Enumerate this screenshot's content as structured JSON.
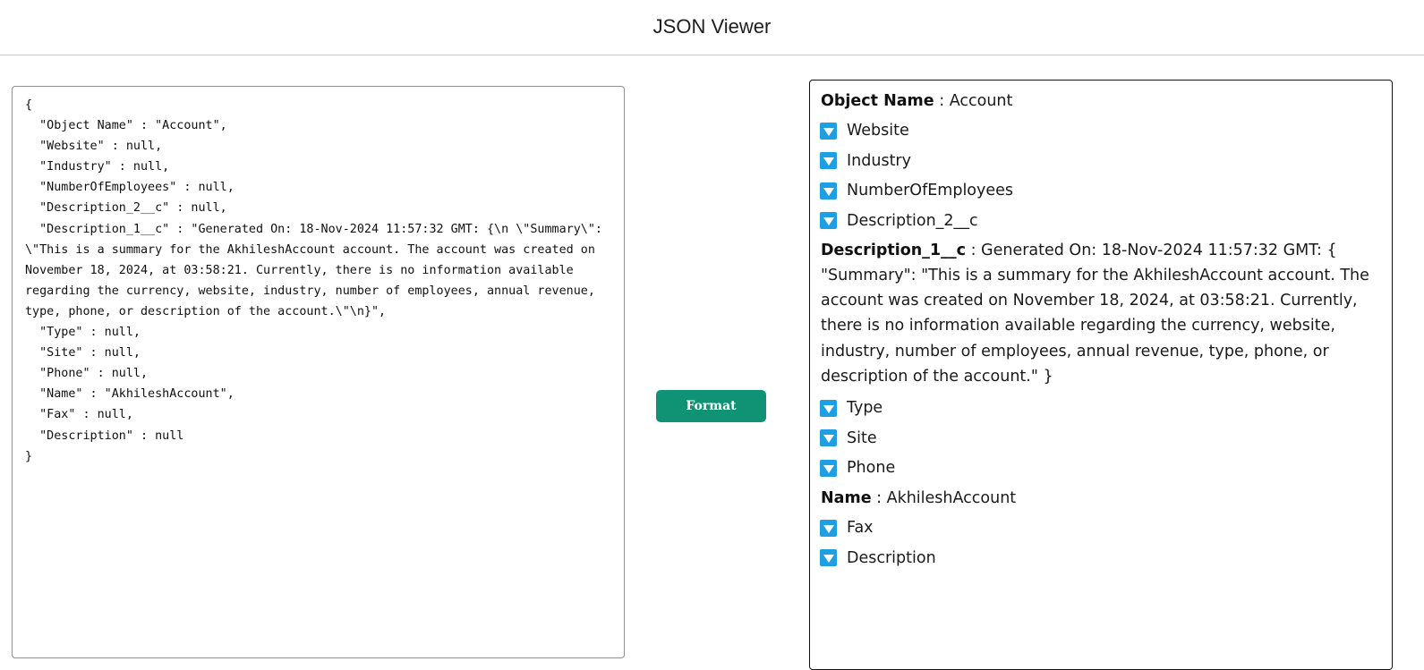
{
  "header": {
    "title": "JSON Viewer"
  },
  "input": {
    "value": "{\n  \"Object Name\" : \"Account\",\n  \"Website\" : null,\n  \"Industry\" : null,\n  \"NumberOfEmployees\" : null,\n  \"Description_2__c\" : null,\n  \"Description_1__c\" : \"Generated On: 18-Nov-2024 11:57:32 GMT: {\\n \\\"Summary\\\": \\\"This is a summary for the AkhileshAccount account. The account was created on November 18, 2024, at 03:58:21. Currently, there is no information available regarding the currency, website, industry, number of employees, annual revenue, type, phone, or description of the account.\\\"\\n}\",\n  \"Type\" : null,\n  \"Site\" : null,\n  \"Phone\" : null,\n  \"Name\" : \"AkhileshAccount\",\n  \"Fax\" : null,\n  \"Description\" : null\n}"
  },
  "toolbar": {
    "format_label": "Format"
  },
  "viewer": {
    "separator": " : ",
    "object_name": {
      "key": "Object Name",
      "value": "Account"
    },
    "website": "Website",
    "industry": "Industry",
    "employees": "NumberOfEmployees",
    "description_2": "Description_2__c",
    "description_1": {
      "key": "Description_1__c",
      "value": "Generated On: 18-Nov-2024 11:57:32 GMT: { \"Summary\": \"This is a summary for the AkhileshAccount account. The account was created on November 18, 2024, at 03:58:21. Currently, there is no information available regarding the currency, website, industry, number of employees, annual revenue, type, phone, or description of the account.\" }"
    },
    "type": "Type",
    "site": "Site",
    "phone": "Phone",
    "name": {
      "key": "Name",
      "value": "AkhileshAccount"
    },
    "fax": "Fax",
    "description": "Description"
  },
  "icons": {
    "toggle": "triangle-down-icon",
    "toggle_color": "#1e9fe4"
  },
  "colors": {
    "button_bg": "#0f9374",
    "button_text": "#ffffff"
  }
}
